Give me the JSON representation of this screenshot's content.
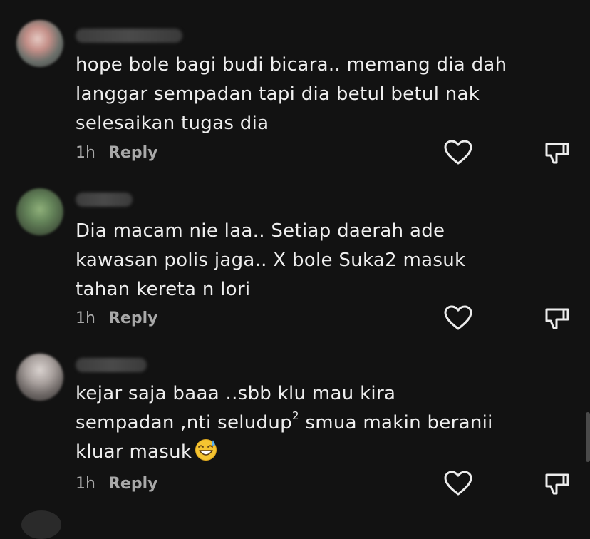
{
  "comments": [
    {
      "lines": [
        "hope bole bagi budi bicara.. memang dia dah",
        "langgar sempadan tapi dia betul betul nak",
        "selesaikan tugas dia"
      ],
      "time": "1h",
      "reply": "Reply"
    },
    {
      "lines": [
        "Dia macam nie laa.. Setiap daerah ade",
        "kawasan polis jaga.. X bole Suka2 masuk",
        "tahan kereta n lori"
      ],
      "time": "1h",
      "reply": "Reply"
    },
    {
      "line1": "kejar saja baaa ..sbb klu mau kira",
      "line2_pre": "sempadan ,nti seludup",
      "line2_sup": "2",
      "line2_post": " smua makin beranii",
      "line3": "kluar masuk",
      "emoji": "grinning-sweat-emoji",
      "time": "1h",
      "reply": "Reply"
    }
  ],
  "icons": {
    "like": "heart-outline-icon",
    "dislike": "thumbs-down-outline-icon"
  },
  "colors": {
    "background": "#121212",
    "text": "#eeeeee",
    "meta": "#a8a8a8"
  }
}
